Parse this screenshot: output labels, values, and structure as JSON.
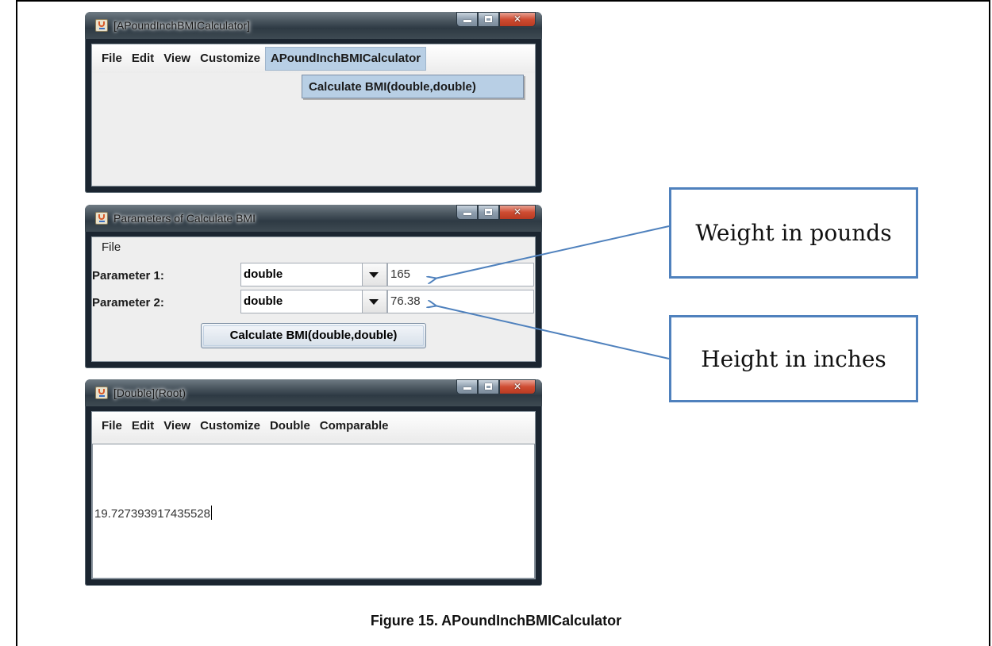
{
  "window1": {
    "title": "[APoundInchBMICalculator]",
    "menu": [
      "File",
      "Edit",
      "View",
      "Customize",
      "APoundInchBMICalculator"
    ],
    "dropdown_item": "Calculate BMI(double,double)"
  },
  "window2": {
    "title": "Parameters of Calculate BMI",
    "menu": [
      "File"
    ],
    "param1_label": "Parameter 1:",
    "param1_type": "double",
    "param1_value": "165",
    "param2_label": "Parameter 2:",
    "param2_type": "double",
    "param2_value": "76.38",
    "button_label": "Calculate BMI(double,double)"
  },
  "window3": {
    "title": "[Double](Root)",
    "menu": [
      "File",
      "Edit",
      "View",
      "Customize",
      "Double",
      "Comparable"
    ],
    "result": "19.727393917435528"
  },
  "callouts": {
    "weight": "Weight in pounds",
    "height": "Height in inches"
  },
  "caption": "Figure 15. APoundInchBMICalculator",
  "colors": {
    "callout_border": "#4f81bd",
    "menu_highlight": "#b8cfe5"
  }
}
